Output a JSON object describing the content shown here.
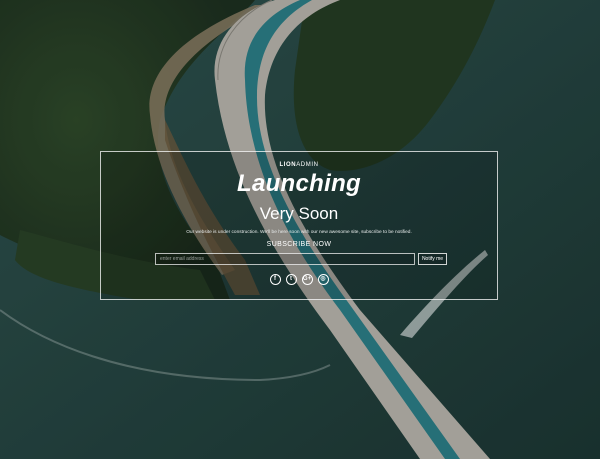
{
  "brand": {
    "bold": "LION",
    "light": "ADMIN"
  },
  "hero": {
    "title": "Launching",
    "subtitle": "Very Soon",
    "note": "Our website is under construction. We'll be here soon with our new awesome site, subscribe to be notified.",
    "subscribe_label": "SUBSCRIBE NOW"
  },
  "form": {
    "email_placeholder": "enter email address",
    "notify_label": "Notify me"
  },
  "socials": [
    {
      "name": "facebook-icon",
      "glyph": "f"
    },
    {
      "name": "twitter-icon",
      "glyph": "t"
    },
    {
      "name": "google-plus-icon",
      "glyph": "G+"
    },
    {
      "name": "instagram-icon",
      "glyph": "◎"
    }
  ]
}
